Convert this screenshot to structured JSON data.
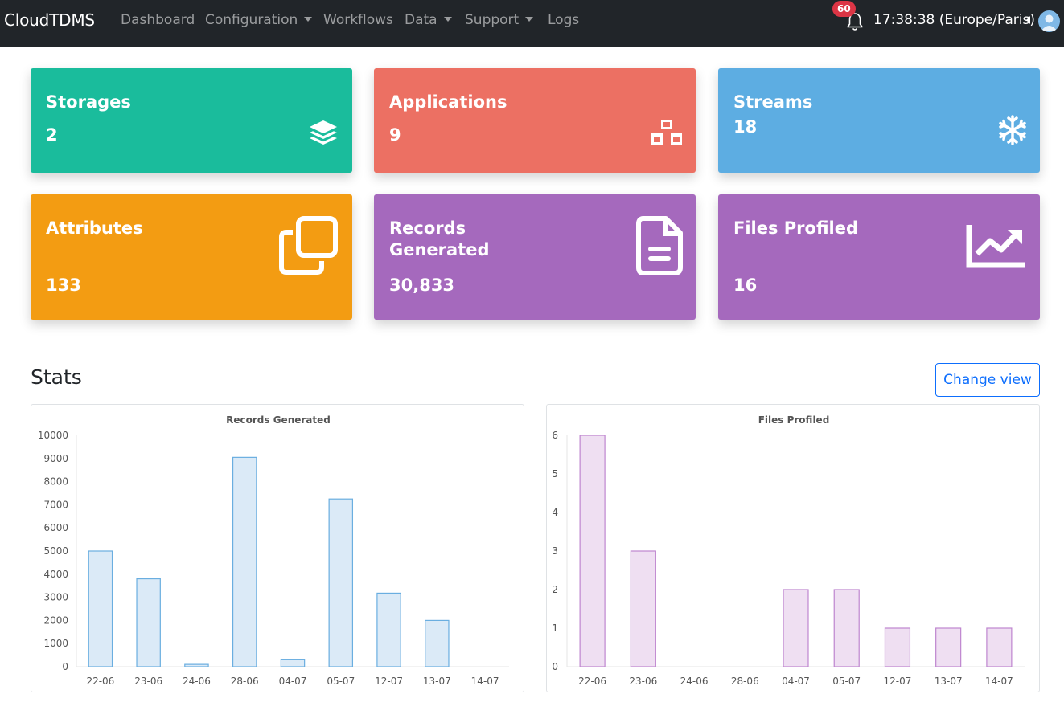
{
  "navbar": {
    "brand": "CloudTDMS",
    "items": [
      {
        "label": "Dashboard",
        "dropdown": false
      },
      {
        "label": "Configuration",
        "dropdown": true
      },
      {
        "label": "Workflows",
        "dropdown": false
      },
      {
        "label": "Data",
        "dropdown": true
      },
      {
        "label": "Support",
        "dropdown": true
      },
      {
        "label": "Logs",
        "dropdown": false
      }
    ],
    "notification_count": "60",
    "clock": "17:38:38 (Europe/Paris)",
    "icons": {
      "bell": "bell-icon",
      "avatar": "user-avatar-icon",
      "collapse": "caret-left-icon"
    }
  },
  "cards": [
    {
      "title": "Storages",
      "value": "2",
      "color": "#1abc9c",
      "icon": "layers-icon"
    },
    {
      "title": "Applications",
      "value": "9",
      "color": "#ec7063",
      "icon": "cubes-icon"
    },
    {
      "title": "Streams",
      "value": "18",
      "color": "#5dade2",
      "icon": "snowflake-icon"
    },
    {
      "title": "Attributes",
      "value": "133",
      "color": "#f39c12",
      "icon": "clone-icon"
    },
    {
      "title": "Records Generated",
      "value": "30,833",
      "color": "#a569bd",
      "icon": "file-icon"
    },
    {
      "title": "Files Profiled",
      "value": "16",
      "color": "#a569bd",
      "icon": "chart-line-icon"
    }
  ],
  "stats": {
    "title": "Stats",
    "change_view_label": "Change view"
  },
  "chart_data": [
    {
      "type": "bar",
      "title": "Records Generated",
      "categories": [
        "22-06",
        "23-06",
        "24-06",
        "28-06",
        "04-07",
        "05-07",
        "12-07",
        "13-07",
        "14-07"
      ],
      "values": [
        5000,
        3800,
        100,
        9050,
        300,
        7250,
        3180,
        2000,
        0
      ],
      "ylim": [
        0,
        10000
      ],
      "yticks": [
        0,
        1000,
        2000,
        3000,
        4000,
        5000,
        6000,
        7000,
        8000,
        9000,
        10000
      ],
      "fill": "#dbeaf7",
      "stroke": "#6aaee0",
      "grid": false
    },
    {
      "type": "bar",
      "title": "Files Profiled",
      "categories": [
        "22-06",
        "23-06",
        "24-06",
        "28-06",
        "04-07",
        "05-07",
        "12-07",
        "13-07",
        "14-07"
      ],
      "values": [
        6,
        3,
        0,
        0,
        2,
        2,
        1,
        1,
        1
      ],
      "ylim": [
        0,
        6
      ],
      "yticks": [
        0,
        1,
        2,
        3,
        4,
        5,
        6
      ],
      "fill": "#efdff2",
      "stroke": "#be85cf",
      "grid": false
    }
  ]
}
